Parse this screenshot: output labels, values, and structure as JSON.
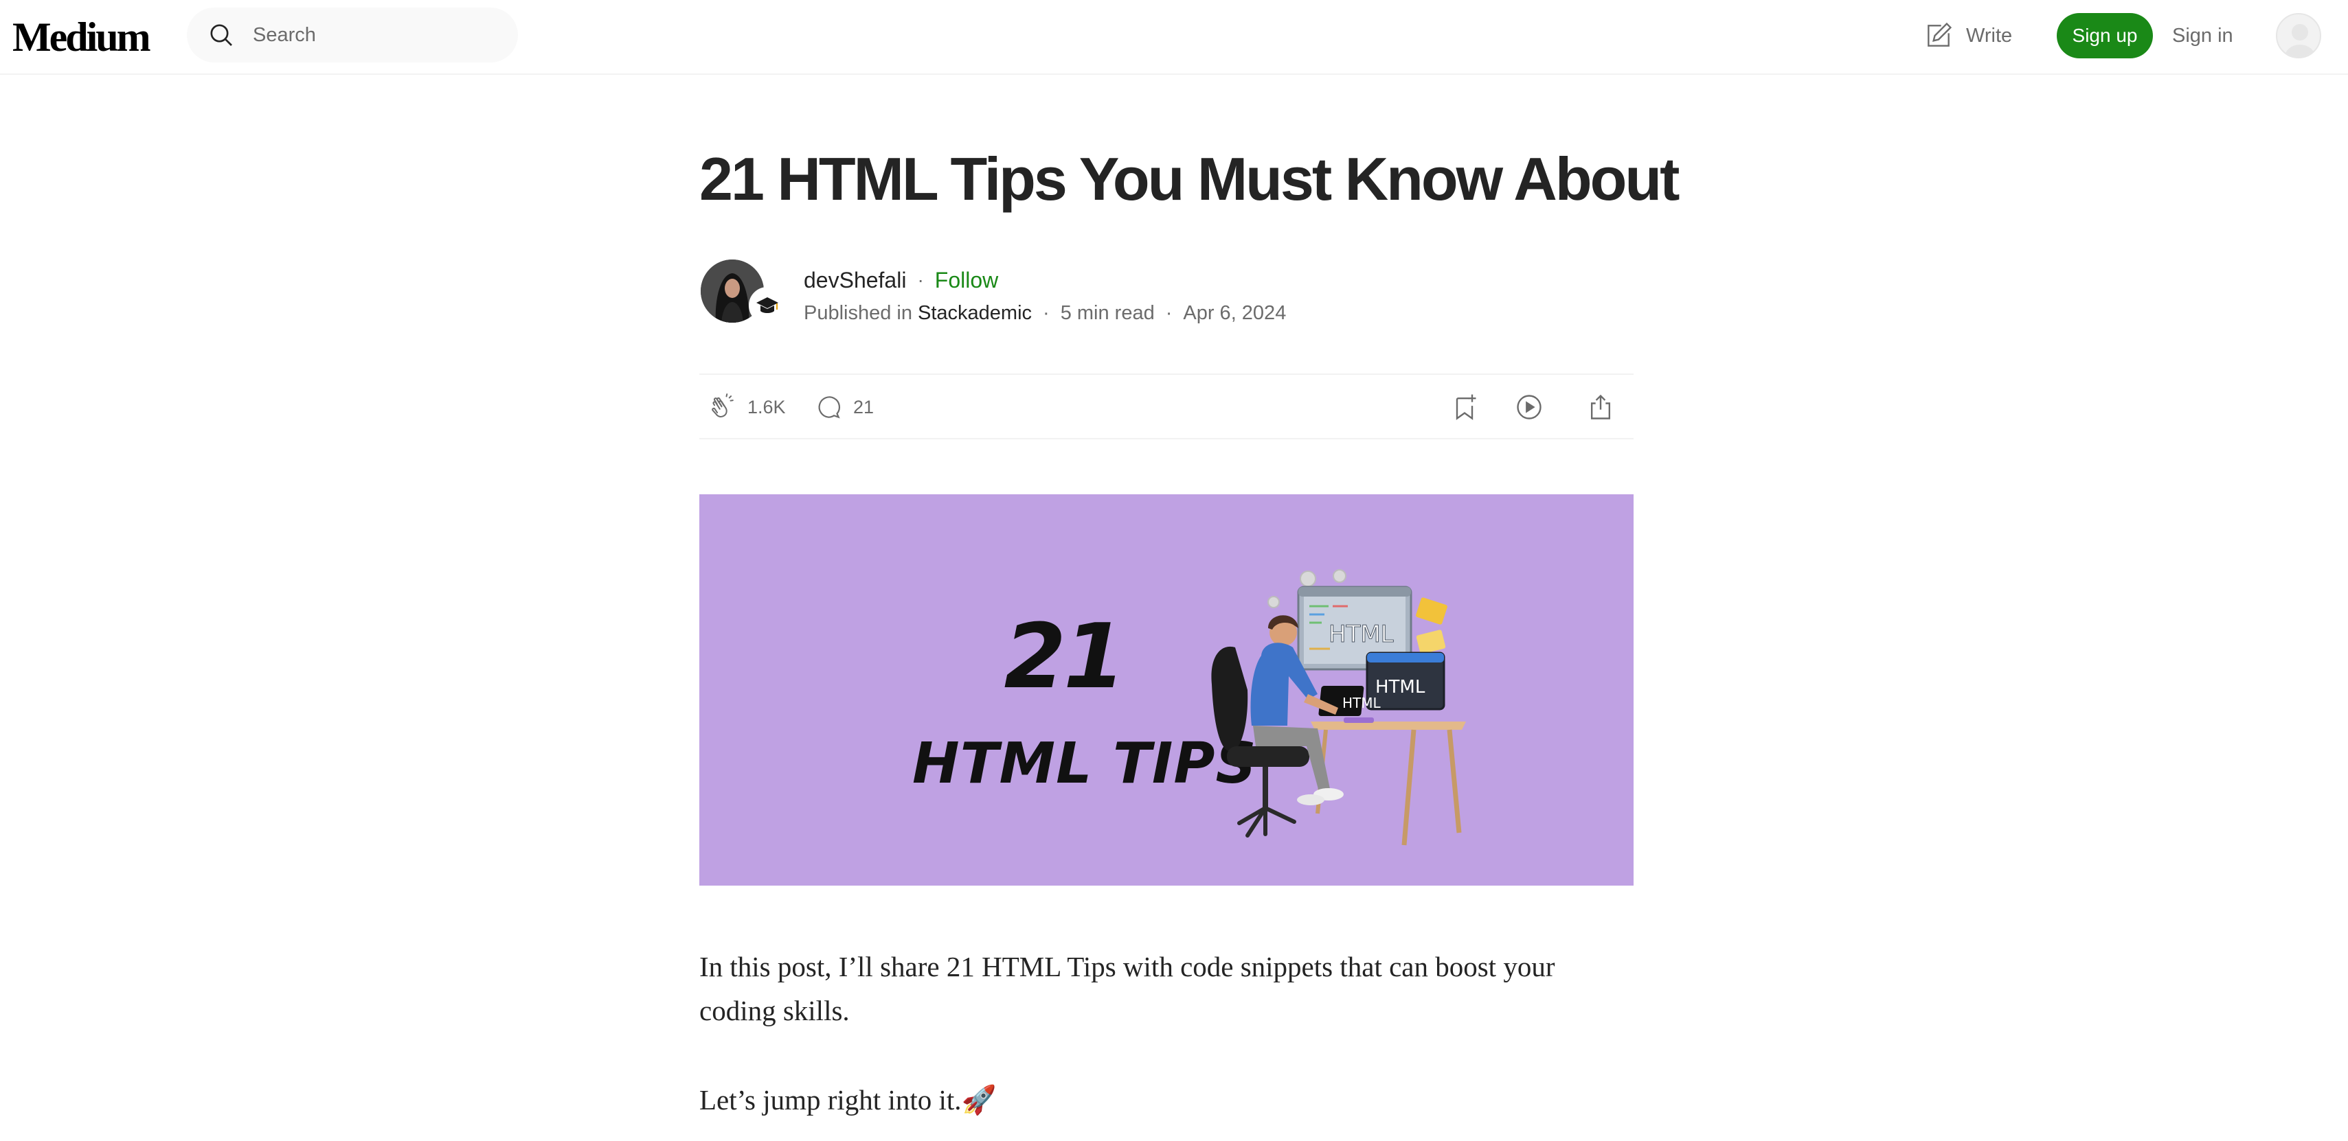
{
  "nav": {
    "logo": "Medium",
    "search_placeholder": "Search",
    "write_label": "Write",
    "signup_label": "Sign up",
    "signin_label": "Sign in"
  },
  "article": {
    "title": "21 HTML Tips You Must Know About",
    "author": "devShefali",
    "follow_label": "Follow",
    "published_in_label": "Published in",
    "publication": "Stackademic",
    "read_time": "5 min read",
    "date": "Apr 6, 2024",
    "claps": "1.6K",
    "responses": "21",
    "hero": {
      "number": "21",
      "caption": "HTML TIPS",
      "screen_label_1": "HTML",
      "screen_label_2": "HTML",
      "screen_label_3": "HTML"
    },
    "paragraphs": [
      "In this post, I’ll share 21 HTML Tips with code snippets that can boost your coding skills.",
      "Let’s jump right into it.🚀"
    ]
  },
  "icons": {
    "search": "search-icon",
    "write": "write-icon",
    "clap": "clap-icon",
    "response": "response-icon",
    "bookmark": "bookmark-icon",
    "listen": "play-icon",
    "share": "share-icon"
  },
  "colors": {
    "accent_green": "#1a8917",
    "hero_background": "#bfa1e3",
    "text": "#242424",
    "muted": "#6b6b6b"
  }
}
